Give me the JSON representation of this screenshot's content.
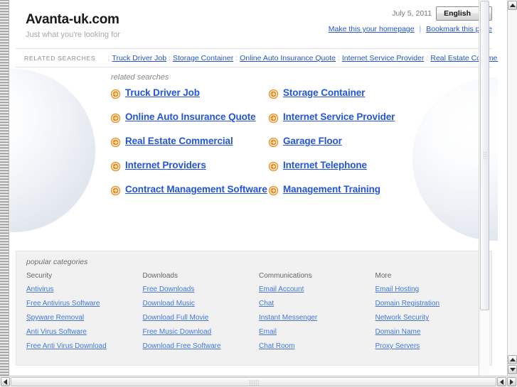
{
  "header": {
    "site_title": "Avanta-uk.com",
    "tagline": "Just what you're looking for",
    "date": "July 5, 2011",
    "language": "English",
    "make_homepage": "Make this your homepage",
    "bookmark": "Bookmark this page",
    "link_separator": "|"
  },
  "related_searches_bar": {
    "label": "RELATED SEARCHES",
    "items": [
      "Truck Driver Job",
      "Storage Container",
      "Online Auto Insurance Quote",
      "Internet Service Provider",
      "Real Estate Commercial"
    ],
    "separator": ":"
  },
  "main": {
    "heading": "related searches",
    "keywords": [
      "Truck Driver Job",
      "Storage Container",
      "Online Auto Insurance Quote",
      "Internet Service Provider",
      "Real Estate Commercial",
      "Garage Floor",
      "Internet Providers",
      "Internet Telephone",
      "Contract Management Software",
      "Management Training"
    ]
  },
  "footer": {
    "heading": "popular categories",
    "columns": [
      {
        "title": "Security",
        "links": [
          "Antivirus",
          "Free Antivirus Software",
          "Spyware Removal",
          "Anti Virus Software",
          "Free Anti Virus Download"
        ]
      },
      {
        "title": "Downloads",
        "links": [
          "Free Downloads",
          "Download Music",
          "Download Full Movie",
          "Free Music Download",
          "Download Free Software"
        ]
      },
      {
        "title": "Communications",
        "links": [
          "Email Account",
          "Chat",
          "Instant Messenger",
          "Email",
          "Chat Room"
        ]
      },
      {
        "title": "More",
        "links": [
          "Email Hosting",
          "Domain Registration",
          "Network Security",
          "Domain Name",
          "Proxy Servers"
        ]
      }
    ]
  },
  "colors": {
    "link_blue": "#2255dd",
    "arrow_orange": "#ef8a14",
    "footer_bg": "#f1f1f1",
    "sphere": "#e2e7ef"
  }
}
